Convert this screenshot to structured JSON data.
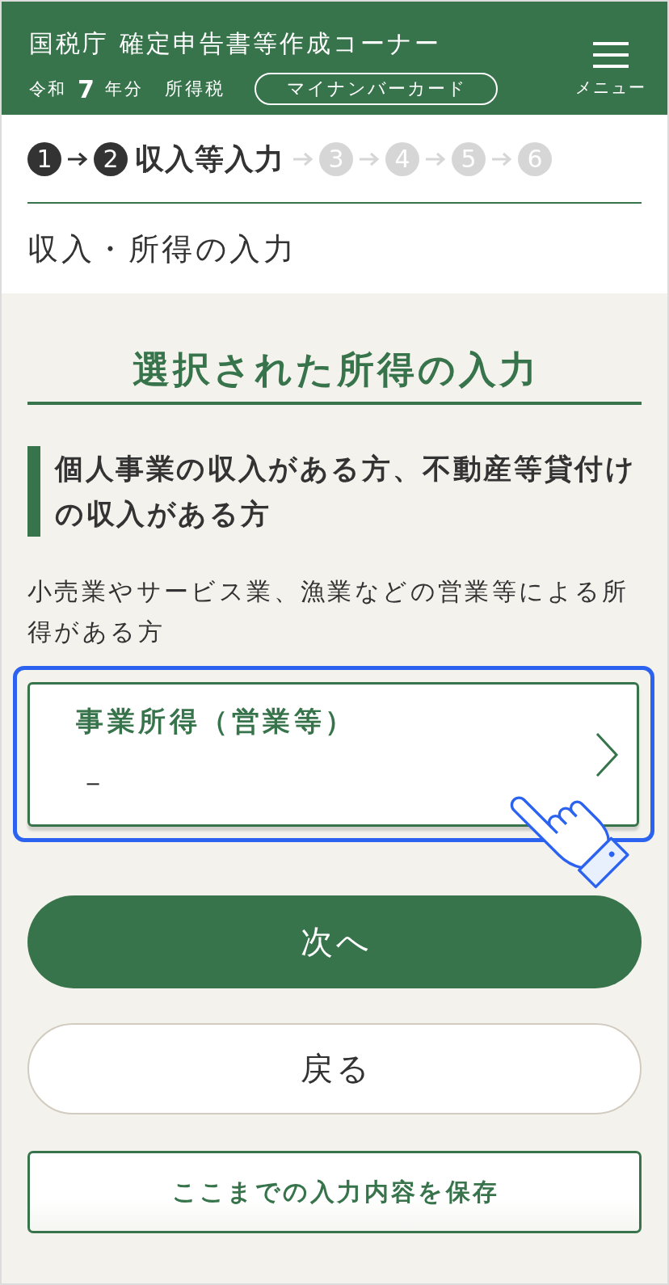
{
  "header": {
    "title": "国税庁 確定申告書等作成コーナー",
    "era": "令和",
    "year": "7",
    "year_suffix": "年分",
    "tax_type": "所得税",
    "login_badge": "マイナンバーカード",
    "menu_label": "メニュー"
  },
  "steps": [
    {
      "number": "1",
      "active": true
    },
    {
      "number": "2",
      "active": true,
      "label": "収入等入力"
    },
    {
      "number": "3",
      "active": false
    },
    {
      "number": "4",
      "active": false
    },
    {
      "number": "5",
      "active": false
    },
    {
      "number": "6",
      "active": false
    }
  ],
  "page_title": "収入・所得の入力",
  "section_title": "選択された所得の入力",
  "category": {
    "title": "個人事業の収入がある方、不動産等貸付けの収入がある方",
    "description": "小売業やサービス業、漁業などの営業等による所得がある方"
  },
  "income_items": [
    {
      "label": "事業所得（営業等）",
      "value": "－",
      "focused": true
    }
  ],
  "buttons": [
    {
      "label": "次へ",
      "kind": "primary"
    },
    {
      "label": "戻る",
      "kind": "secondary"
    },
    {
      "label": "ここまでの入力内容を保存",
      "kind": "outline"
    }
  ]
}
